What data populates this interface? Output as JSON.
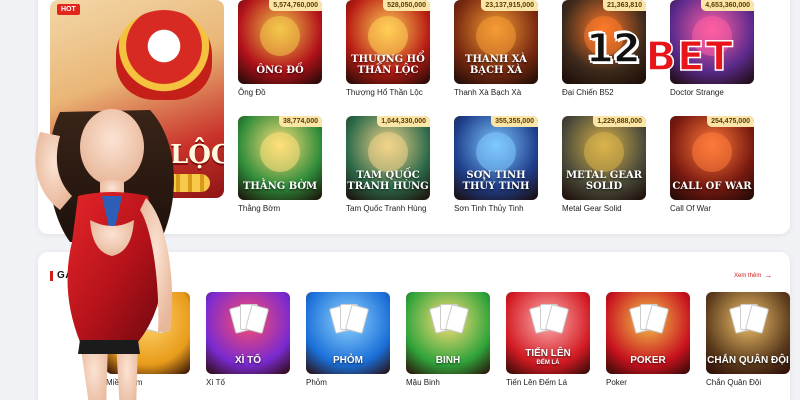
{
  "featured": {
    "badge": "HOT",
    "big_text": "LỘC"
  },
  "slots_row1": [
    {
      "name": "Ông Đồ",
      "jackpot": "5,574,760,000",
      "art": "ÔNG ĐỒ",
      "color": "#b3121a",
      "accent": "#f2c84b"
    },
    {
      "name": "Thượng Hổ Thần Lộc",
      "jackpot": "528,050,000",
      "art": "THƯỢNG HỔ THẦN LỘC",
      "color": "#b81c14",
      "accent": "#ffcf56"
    },
    {
      "name": "Thanh Xà Bạch Xà",
      "jackpot": "23,137,915,000",
      "art": "THANH XÀ BẠCH XÀ",
      "color": "#7a2a10",
      "accent": "#f59b35"
    },
    {
      "name": "Đại Chiến B52",
      "jackpot": "21,363,810",
      "art": "",
      "color": "#3d2a1c",
      "accent": "#ff7a2a"
    },
    {
      "name": "Doctor Strange",
      "jackpot": "4,653,360,000",
      "art": "",
      "color": "#5b2a8c",
      "accent": "#ff5fa3"
    }
  ],
  "slots_row2": [
    {
      "name": "Thằng Bờm",
      "jackpot": "38,774,000",
      "art": "THẰNG BỜM",
      "color": "#2f8c3a",
      "accent": "#ffe07a"
    },
    {
      "name": "Tam Quốc Tranh Hùng",
      "jackpot": "1,044,330,000",
      "art": "TAM QUỐC TRANH HÙNG",
      "color": "#2d6b4a",
      "accent": "#f2d48a"
    },
    {
      "name": "Sơn Tinh Thủy Tinh",
      "jackpot": "355,355,000",
      "art": "SƠN TINH THỦY TINH",
      "color": "#1f3f8c",
      "accent": "#7ec8ff"
    },
    {
      "name": "Metal Gear Solid",
      "jackpot": "1,229,888,000",
      "art": "METAL GEAR SOLID",
      "color": "#4a4a3a",
      "accent": "#d9b24a"
    },
    {
      "name": "Call Of War",
      "jackpot": "254,475,000",
      "art": "CALL OF WAR",
      "color": "#7a1a10",
      "accent": "#ff7a3a"
    }
  ],
  "section": {
    "title": "GAME",
    "see_more": "Xem thêm"
  },
  "card_games": [
    {
      "name": "Miền Nam",
      "art": "",
      "sub": "",
      "color": "#e89b1a",
      "accent": "#ffd36a"
    },
    {
      "name": "Xì Tố",
      "art": "XÌ TỐ",
      "sub": "",
      "color": "#7a2ad0",
      "accent": "#ff4d6d"
    },
    {
      "name": "Phỏm",
      "art": "PHỎM",
      "sub": "",
      "color": "#1a6fd8",
      "accent": "#8fd3ff"
    },
    {
      "name": "Mậu Binh",
      "art": "BINH",
      "sub": "",
      "color": "#2fa33a",
      "accent": "#ffe07a"
    },
    {
      "name": "Tiến Lên Đếm Lá",
      "art": "TIẾN LÊN",
      "sub": "ĐẾM LÁ",
      "color": "#d21a22",
      "accent": "#ffb0b0"
    },
    {
      "name": "Poker",
      "art": "POKER",
      "sub": "",
      "color": "#c8121e",
      "accent": "#f5c54a"
    },
    {
      "name": "Chắn Quân Đội",
      "art": "CHẮN QUÂN ĐỘI",
      "sub": "",
      "color": "#5a3a1c",
      "accent": "#f2c26a"
    }
  ],
  "brand": {
    "num": "12",
    "word": "BET"
  }
}
